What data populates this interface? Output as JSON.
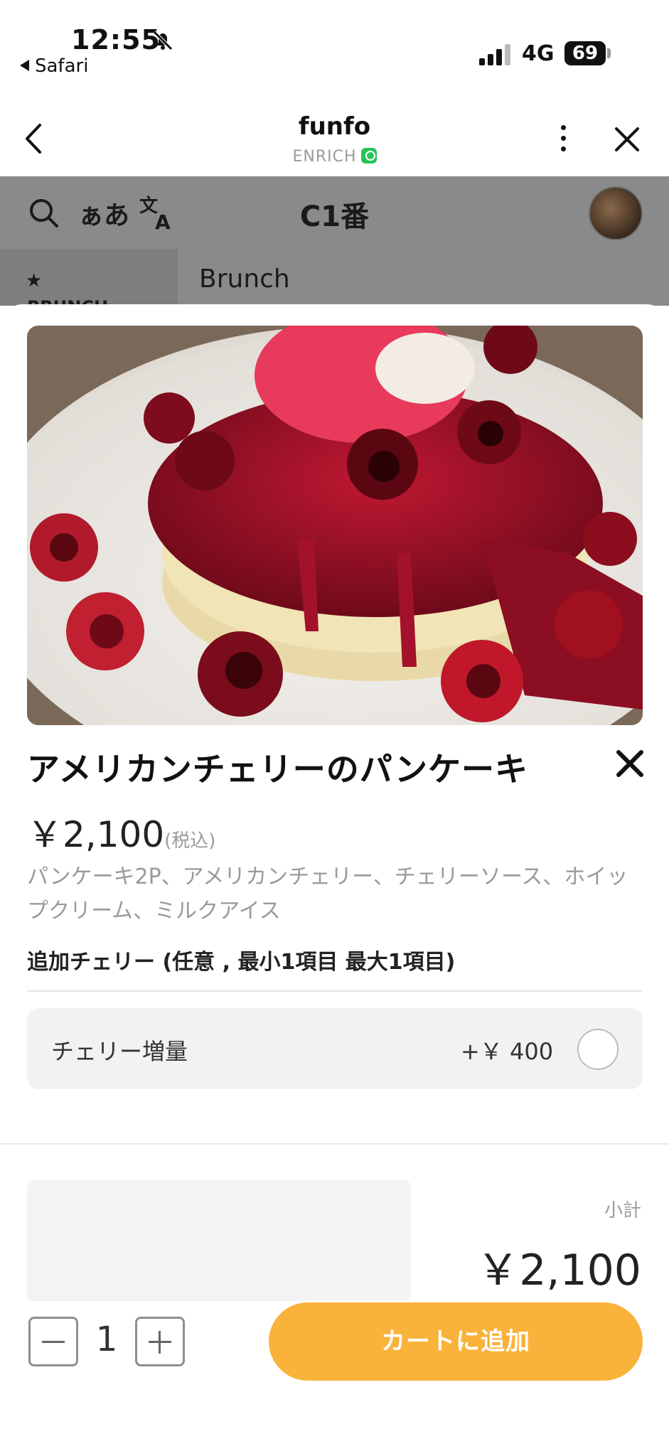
{
  "status_bar": {
    "time": "12:55",
    "back_app": "Safari",
    "network": "4G",
    "battery": "69",
    "icons": [
      "bell-slash-icon",
      "signal-icon",
      "battery-icon"
    ]
  },
  "header": {
    "title": "funfo",
    "subtitle": "ENRICH",
    "icons": [
      "chevron-left-icon",
      "more-vertical-icon",
      "close-icon",
      "verified-badge-icon"
    ]
  },
  "toolbar": {
    "kana_label": "ぁあ",
    "table_label": "C1番",
    "icons": [
      "search-icon",
      "translate-icon",
      "avatar"
    ]
  },
  "category": {
    "side_label": "BRUNCH",
    "title": "Brunch",
    "icons": [
      "star-icon"
    ]
  },
  "item": {
    "name": "アメリカンチェリーのパンケーキ",
    "price": "￥2,100",
    "tax_note": "(税込)",
    "description": "パンケーキ2P、アメリカンチェリー、チェリーソース、ホイップクリーム、ミルクアイス",
    "icons": [
      "close-x-icon"
    ]
  },
  "options": {
    "heading": "追加チェリー (任意 , 最小1項目 最大1項目)",
    "items": [
      {
        "label": "チェリー増量",
        "price": "+￥ 400",
        "selected": false
      }
    ]
  },
  "footer": {
    "subtotal_label": "小計",
    "subtotal_value": "￥2,100",
    "quantity": "1",
    "add_to_cart": "カートに追加"
  },
  "colors": {
    "accent": "#f9b23a",
    "overlay": "#8a8a8a",
    "badge_green": "#29c25a"
  }
}
